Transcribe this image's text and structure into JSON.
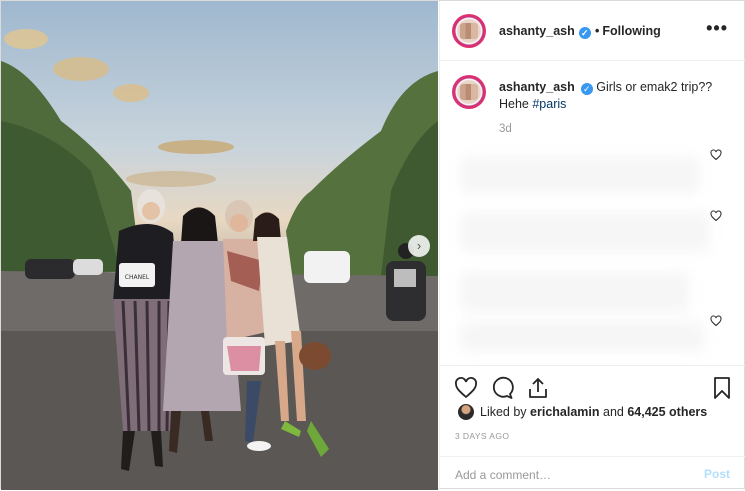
{
  "header": {
    "username": "ashanty_ash",
    "dot": "•",
    "follow_state": "Following",
    "more_glyph": "•••",
    "verified_glyph": "✓"
  },
  "caption": {
    "username": "ashanty_ash",
    "text": "Girls or emak2 trip??",
    "line2_prefix": "Hehe ",
    "hashtag": "#paris",
    "time_ago": "3d"
  },
  "photo": {
    "bag_text": "CHANEL",
    "next_glyph": "›"
  },
  "likes": {
    "prefix": "Liked by ",
    "user": "erichalamin",
    "middle": " and ",
    "count": "64,425 others"
  },
  "post_date": "3 DAYS AGO",
  "comment_box": {
    "placeholder": "Add a comment…",
    "post_label": "Post"
  },
  "icons": [
    "heart-icon",
    "comment-icon",
    "share-icon",
    "bookmark-icon",
    "more-icon",
    "verified-badge-icon"
  ],
  "colors": {
    "link": "#003569",
    "verified": "#3897f0",
    "post_disabled": "#b2dffc",
    "muted": "#999999"
  }
}
